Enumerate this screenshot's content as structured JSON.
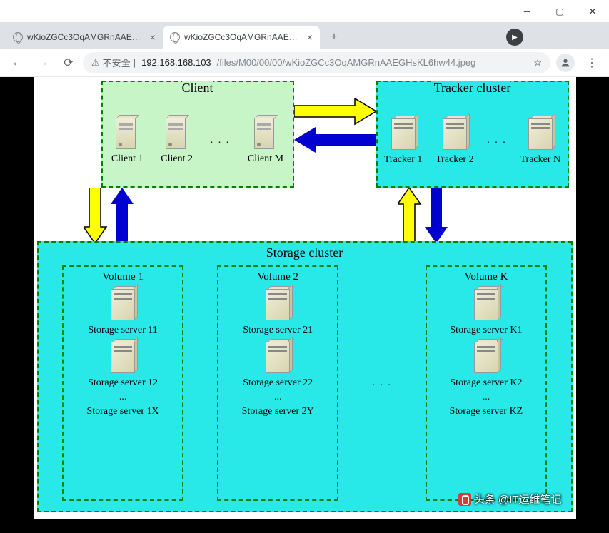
{
  "window": {
    "tabs": [
      {
        "title": "wKioZGCc3OqAMGRnAAEGHs",
        "active": false
      },
      {
        "title": "wKioZGCc3OqAMGRnAAEGHs",
        "active": true
      }
    ],
    "insecure_label": "不安全",
    "url_host": "192.168.168.103",
    "url_path": "/files/M00/00/00/wKioZGCc3OqAMGRnAAEGHsKL6hw44.jpeg"
  },
  "diagram": {
    "client": {
      "title": "Client",
      "nodes": [
        "Client 1",
        "Client 2",
        "Client M"
      ],
      "ellipsis": ". . ."
    },
    "tracker": {
      "title": "Tracker cluster",
      "nodes": [
        "Tracker 1",
        "Tracker 2",
        "Tracker N"
      ],
      "ellipsis": ". . ."
    },
    "storage": {
      "title": "Storage cluster",
      "ellipsis": ". . .",
      "volumes": [
        {
          "title": "Volume 1",
          "servers": [
            "Storage server 11",
            "Storage server 12"
          ],
          "more": "...",
          "last": "Storage server 1X"
        },
        {
          "title": "Volume 2",
          "servers": [
            "Storage server 21",
            "Storage server 22"
          ],
          "more": "...",
          "last": "Storage server 2Y"
        },
        {
          "title": "Volume K",
          "servers": [
            "Storage server K1",
            "Storage server K2"
          ],
          "more": "...",
          "last": "Storage server KZ"
        }
      ]
    }
  },
  "watermark": "头条 @IT运维笔记"
}
